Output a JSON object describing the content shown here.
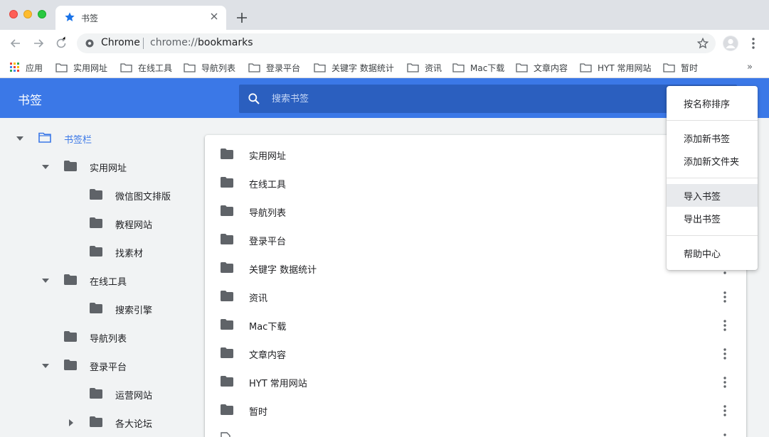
{
  "browser": {
    "tab_title": "书签",
    "omnibox_label": "Chrome",
    "omnibox_url_scheme": "chrome://",
    "omnibox_url_path": "bookmarks"
  },
  "bookmarks_bar": {
    "items": [
      "应用",
      "实用网址",
      "在线工具",
      "导航列表",
      "登录平台",
      "关键字 数据统计",
      "资讯",
      "Mac下载",
      "文章内容",
      "HYT 常用网站",
      "暂时"
    ],
    "more": "»"
  },
  "manager": {
    "title": "书签",
    "search_placeholder": "搜索书签"
  },
  "tree": [
    {
      "label": "书签栏",
      "arrow": "down",
      "selected": true
    },
    {
      "label": "实用网址",
      "arrow": "down"
    },
    {
      "label": "微信图文排版",
      "arrow": "none"
    },
    {
      "label": "教程网站",
      "arrow": "none"
    },
    {
      "label": "找素材",
      "arrow": "none"
    },
    {
      "label": "在线工具",
      "arrow": "down"
    },
    {
      "label": "搜索引擎",
      "arrow": "none"
    },
    {
      "label": "导航列表",
      "arrow": "none"
    },
    {
      "label": "登录平台",
      "arrow": "down"
    },
    {
      "label": "运营网站",
      "arrow": "none"
    },
    {
      "label": "各大论坛",
      "arrow": "right"
    }
  ],
  "list": [
    "实用网址",
    "在线工具",
    "导航列表",
    "登录平台",
    "关键字 数据统计",
    "资讯",
    "Mac下载",
    "文章内容",
    "HYT 常用网站",
    "暂时"
  ],
  "menu": [
    {
      "label": "按名称排序",
      "group": 0
    },
    {
      "label": "添加新书签",
      "group": 1
    },
    {
      "label": "添加新文件夹",
      "group": 1
    },
    {
      "label": "导入书签",
      "group": 2,
      "hover": true
    },
    {
      "label": "导出书签",
      "group": 2
    },
    {
      "label": "帮助中心",
      "group": 3
    }
  ],
  "colors": {
    "accent": "#3b78e7",
    "search_bg": "#2b5fbf",
    "folder": "#5f6368",
    "selected_folder": "#3b78e7"
  }
}
